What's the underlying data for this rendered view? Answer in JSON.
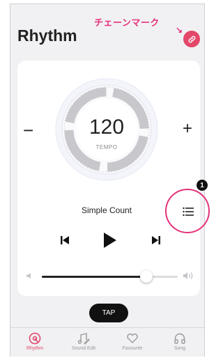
{
  "annotation": {
    "chain_mark_label": "チェーンマーク",
    "arrow": "↘",
    "callout_number": "1"
  },
  "header": {
    "title": "Rhythm"
  },
  "tempo": {
    "value": "120",
    "label": "TEMPO",
    "decrease": "−",
    "increase": "+"
  },
  "count": {
    "label": "Simple Count"
  },
  "volume": {
    "level": 0.77
  },
  "tap": {
    "label": "TAP"
  },
  "tabs": [
    {
      "label": "Rhythm",
      "icon": "rhythm-icon",
      "active": true
    },
    {
      "label": "Sound Edit",
      "icon": "music-note-edit-icon",
      "active": false
    },
    {
      "label": "Favourite",
      "icon": "heart-icon",
      "active": false
    },
    {
      "label": "Song",
      "icon": "headphones-icon",
      "active": false
    }
  ],
  "colors": {
    "accent": "#e3476a",
    "annotation": "#e6317c",
    "dial_ring": "#c8c8cc"
  }
}
